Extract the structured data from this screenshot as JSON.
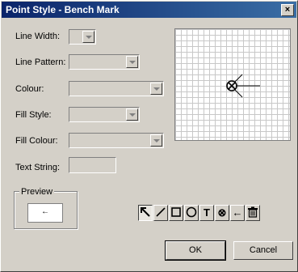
{
  "window": {
    "title": "Point Style - Bench Mark",
    "close_label": "×"
  },
  "fields": {
    "line_width_label": "Line Width:",
    "line_pattern_label": "Line Pattern:",
    "colour_label": "Colour:",
    "fill_style_label": "Fill Style:",
    "fill_colour_label": "Fill Colour:",
    "text_string_label": "Text String:",
    "text_string_value": ""
  },
  "preview": {
    "label": "Preview",
    "symbol": "←"
  },
  "tools": [
    {
      "name": "pointer-tool",
      "icon": "arrow-pointer-icon",
      "active": true
    },
    {
      "name": "line-tool",
      "icon": "line-icon"
    },
    {
      "name": "rectangle-tool",
      "icon": "rectangle-icon"
    },
    {
      "name": "circle-tool",
      "icon": "circle-icon"
    },
    {
      "name": "text-tool",
      "icon": "text-icon",
      "glyph": "T"
    },
    {
      "name": "bench-mark-tool",
      "icon": "circle-cross-icon",
      "glyph": "⊗"
    },
    {
      "name": "arrow-tool",
      "icon": "left-arrow-icon",
      "glyph": "←"
    },
    {
      "name": "delete-tool",
      "icon": "trash-icon"
    }
  ],
  "buttons": {
    "ok_label": "OK",
    "cancel_label": "Cancel"
  },
  "colors": {
    "title_start": "#0a246a",
    "title_end": "#3a6ea5",
    "face": "#d4d0c8",
    "grid_line": "#c8c8c8"
  }
}
